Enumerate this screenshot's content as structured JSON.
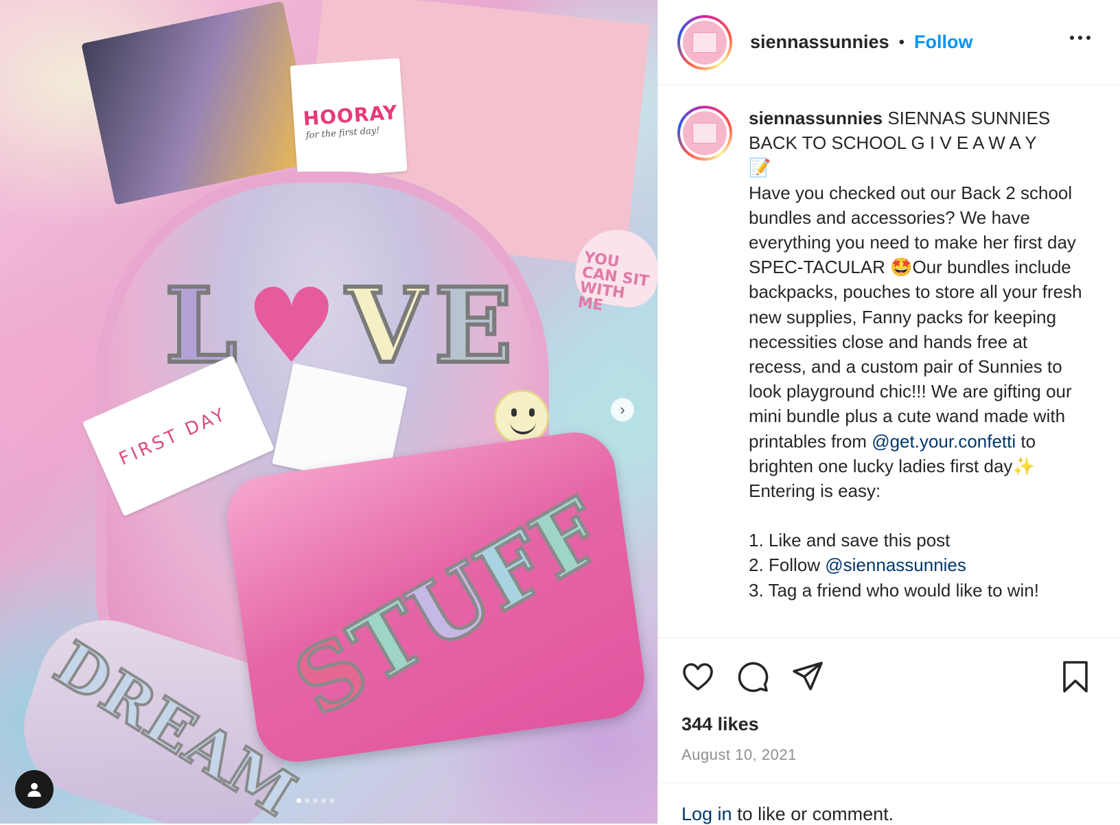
{
  "header": {
    "username": "siennassunnies",
    "separator": "•",
    "follow_label": "Follow",
    "more_icon": "more-horizontal-icon"
  },
  "caption": {
    "username": "siennassunnies",
    "line1": "SIENNAS SUNNIES BACK TO SCHOOL G I V E A W A Y",
    "emoji_memo": "📝",
    "para1_a": "Have you checked out our Back 2 school bundles and accessories? We have everything you need to make her first day SPEC-TACULAR ",
    "emoji_star_struck": "🤩",
    "para1_b": "Our bundles include backpacks, pouches to store all your fresh new supplies, Fanny packs for keeping necessities close and hands free at recess, and a custom pair of Sunnies to look playground chic!!! We are gifting our mini bundle plus a cute wand made with printables from ",
    "mention1": "@get.your.confetti",
    "para1_c": " to brighten one lucky ladies first day",
    "emoji_sparkles": "✨",
    "para1_d": "  Entering is easy:",
    "step1": "1. Like and save this post",
    "step2_prefix": "2. Follow ",
    "step2_mention": "@siennassunnies",
    "step3": "3. Tag a friend who would like to win!"
  },
  "actions": {
    "like_icon": "heart-icon",
    "comment_icon": "comment-icon",
    "share_icon": "send-icon",
    "save_icon": "bookmark-icon",
    "likes": "344 likes",
    "date": "August 10, 2021"
  },
  "login": {
    "link": "Log in",
    "rest": " to like or comment."
  },
  "media": {
    "carousel_dots": 5,
    "active_dot": 1,
    "next_icon": "chevron-right-icon",
    "user_tag_icon": "user-icon",
    "photo_text": {
      "hooray": "HOORAY",
      "hooray_sub": "for the first day!",
      "love_l": "L",
      "love_heart": "♥",
      "love_v": "V",
      "love_e": "E",
      "first_day": "FIRST DAY",
      "stuff": [
        "S",
        "T",
        "U",
        "F",
        "F"
      ],
      "dream": "DREAM",
      "sign": "YOU CAN SIT WITH ME"
    }
  },
  "colors": {
    "accent": "#0095f6",
    "link": "#00376b",
    "text": "#262626",
    "muted": "#8e8e8e"
  }
}
